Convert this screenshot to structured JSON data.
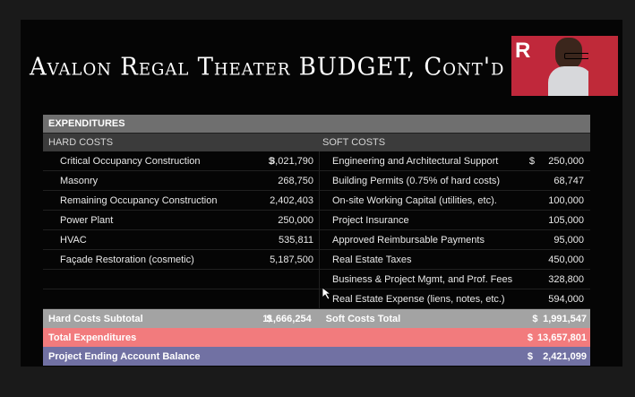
{
  "slide": {
    "title": "Avalon Regal Theater BUDGET, Cont'd",
    "logo_letter": "R"
  },
  "table": {
    "section_header": "EXPENDITURES",
    "hard_costs_header": "HARD COSTS",
    "soft_costs_header": "SOFT COSTS",
    "hard_costs": [
      {
        "label": "Critical Occupancy Construction",
        "dollar": "$",
        "value": "3,021,790"
      },
      {
        "label": "Masonry",
        "dollar": "",
        "value": "268,750"
      },
      {
        "label": "Remaining Occupancy Construction",
        "dollar": "",
        "value": "2,402,403"
      },
      {
        "label": "Power Plant",
        "dollar": "",
        "value": "250,000"
      },
      {
        "label": "HVAC",
        "dollar": "",
        "value": "535,811"
      },
      {
        "label": "Façade Restoration (cosmetic)",
        "dollar": "",
        "value": "5,187,500"
      },
      {
        "label": "",
        "dollar": "",
        "value": ""
      },
      {
        "label": "",
        "dollar": "",
        "value": ""
      }
    ],
    "soft_costs": [
      {
        "label": "Engineering and Architectural Support",
        "dollar": "$",
        "value": "250,000"
      },
      {
        "label": "Building Permits (0.75% of hard costs)",
        "dollar": "",
        "value": "68,747"
      },
      {
        "label": "On-site Working Capital (utilities, etc).",
        "dollar": "",
        "value": "100,000"
      },
      {
        "label": "Project Insurance",
        "dollar": "",
        "value": "105,000"
      },
      {
        "label": "Approved Reimbursable Payments",
        "dollar": "",
        "value": "95,000"
      },
      {
        "label": "Real Estate Taxes",
        "dollar": "",
        "value": "450,000"
      },
      {
        "label": "Business & Project Mgmt, and Prof. Fees",
        "dollar": "",
        "value": "328,800"
      },
      {
        "label": "Real Estate Expense (liens, notes, etc.)",
        "dollar": "",
        "value": "594,000"
      }
    ],
    "hard_subtotal_label": "Hard Costs Subtotal",
    "hard_subtotal_dollar": "$",
    "hard_subtotal_value": "11,666,254",
    "soft_total_label": "Soft Costs Total",
    "soft_total_dollar": "$",
    "soft_total_value": "1,991,547",
    "total_expenditures_label": "Total Expenditures",
    "total_expenditures_dollar": "$",
    "total_expenditures_value": "13,657,801",
    "ending_balance_label": "Project Ending Account Balance",
    "ending_balance_dollar": "$",
    "ending_balance_value": "2,421,099"
  }
}
